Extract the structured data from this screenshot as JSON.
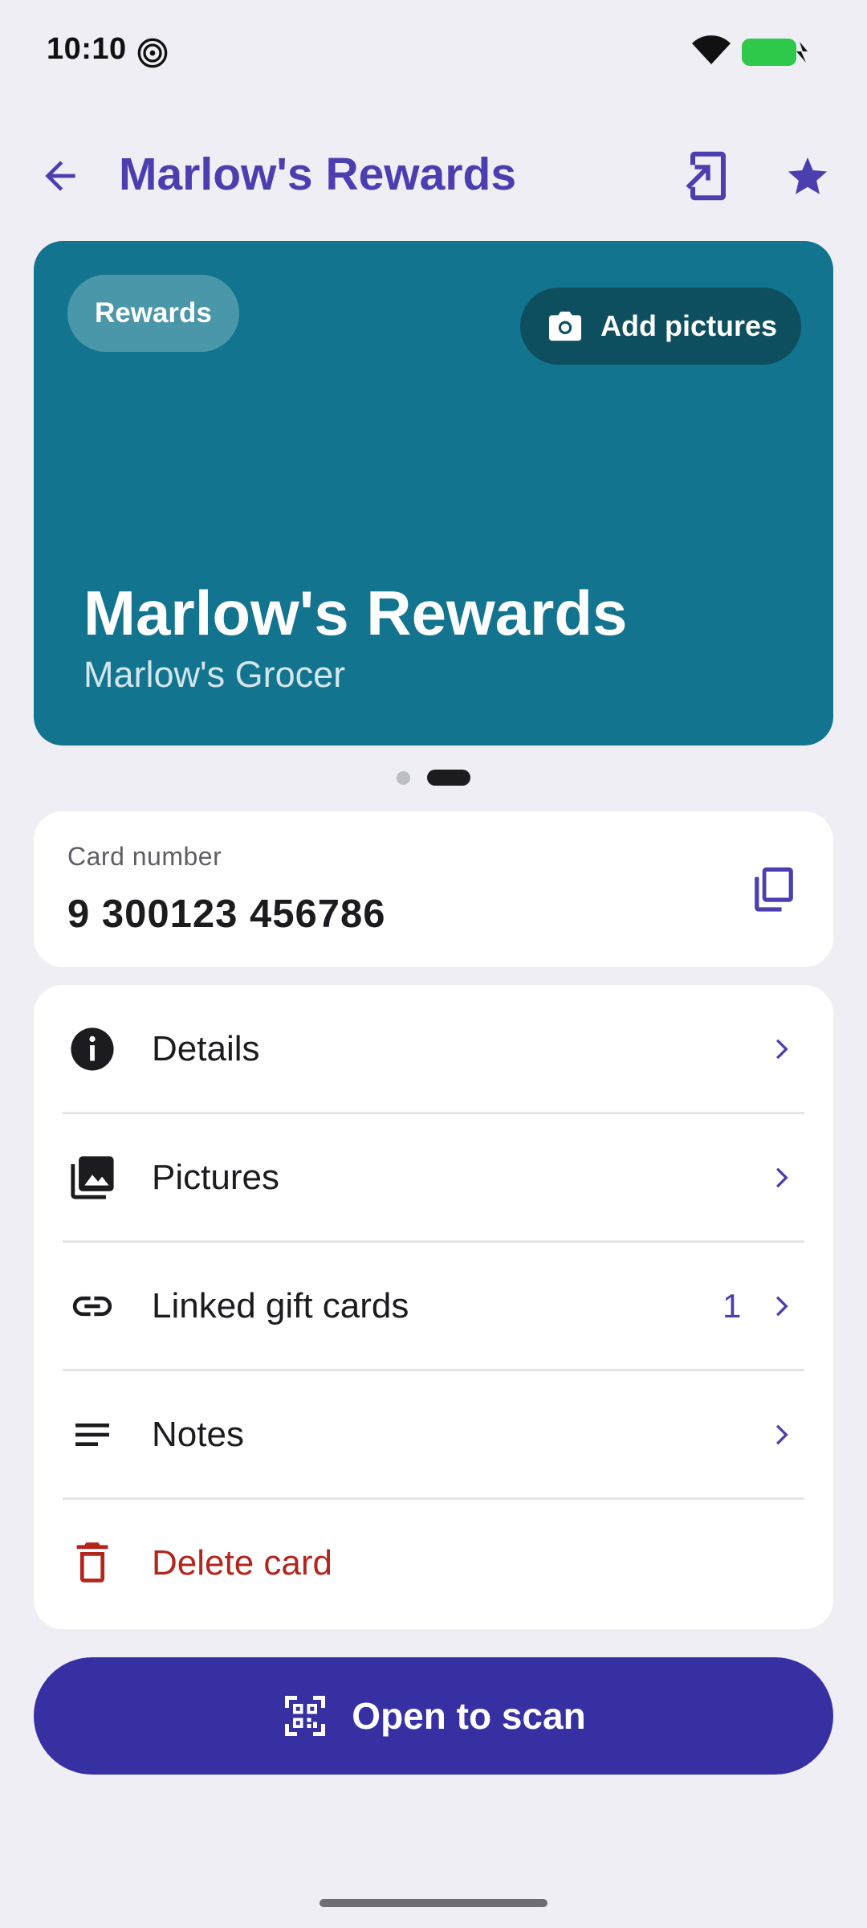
{
  "status_bar": {
    "time": "10:10"
  },
  "app_bar": {
    "title": "Marlow's Rewards"
  },
  "hero": {
    "chip": "Rewards",
    "add_pictures": "Add pictures",
    "title": "Marlow's Rewards",
    "subtitle": "Marlow's Grocer",
    "pages_total": 2,
    "page_active": 2
  },
  "card_number": {
    "label": "Card number",
    "value": "9 300123 456786"
  },
  "menu": {
    "details": "Details",
    "pictures": "Pictures",
    "linked_gift_cards": "Linked gift cards",
    "linked_gift_cards_count": "1",
    "notes": "Notes",
    "delete_card": "Delete card"
  },
  "scan_button": {
    "label": "Open to scan"
  },
  "colors": {
    "accent": "#4b3fb0",
    "card": "#13748f",
    "primary_button": "#3730a3",
    "danger": "#b3261e",
    "background": "#efeef5"
  }
}
